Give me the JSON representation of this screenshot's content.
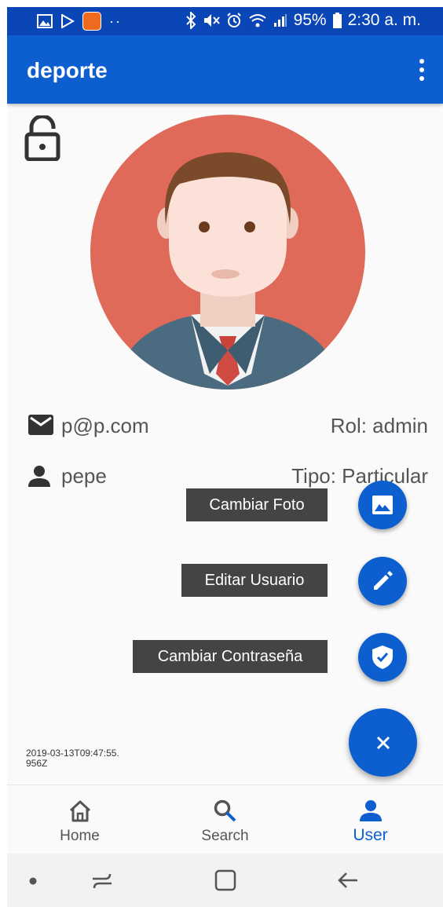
{
  "status_bar": {
    "battery": "95%",
    "time": "2:30 a. m.",
    "icons": [
      "gallery-icon",
      "play-store-icon",
      "app-notification-icon",
      "more-notifications-icon",
      "bluetooth-icon",
      "mute-icon",
      "alarm-icon",
      "wifi-icon",
      "signal-icon",
      "battery-icon"
    ]
  },
  "app_bar": {
    "title": "deporte",
    "menu_icon": "more-vert-icon"
  },
  "profile": {
    "lock_icon": "lock-open-icon",
    "email_icon": "mail-icon",
    "email": "p@p.com",
    "role": "Rol: admin",
    "user_icon": "person-icon",
    "username": "pepe",
    "type": "Tipo: Particular",
    "timestamp": "2019-03-13T09:47:55.956Z"
  },
  "actions": [
    {
      "label": "Cambiar Foto",
      "icon": "image-icon"
    },
    {
      "label": "Editar Usuario",
      "icon": "edit-icon"
    },
    {
      "label": "Cambiar Contraseña",
      "icon": "shield-check-icon"
    }
  ],
  "fab": {
    "icon": "close-icon"
  },
  "bottom_nav": [
    {
      "label": "Home",
      "icon": "home-icon",
      "active": false
    },
    {
      "label": "Search",
      "icon": "search-icon",
      "active": false
    },
    {
      "label": "User",
      "icon": "person-icon",
      "active": true
    }
  ],
  "system_nav": [
    "dot-icon",
    "recents-icon",
    "home-square-icon",
    "back-icon"
  ],
  "colors": {
    "primary": "#0d5fd0",
    "status_bar": "#0a46b6",
    "avatar_bg": "#e06a5a",
    "label_bg": "#444444",
    "text": "#555555"
  }
}
